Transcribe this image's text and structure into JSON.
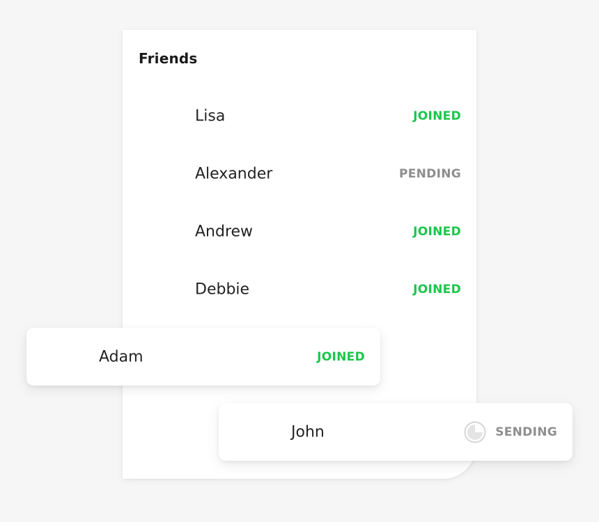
{
  "panel": {
    "title": "Friends"
  },
  "friends": [
    {
      "name": "Lisa",
      "status": "JOINED"
    },
    {
      "name": "Alexander",
      "status": "PENDING"
    },
    {
      "name": "Andrew",
      "status": "JOINED"
    },
    {
      "name": "Debbie",
      "status": "JOINED"
    }
  ],
  "floating_cards": {
    "adam": {
      "name": "Adam",
      "status": "JOINED"
    },
    "john": {
      "name": "John",
      "status": "SENDING",
      "icon": "progress-spinner-icon",
      "progress": 0.25
    }
  },
  "colors": {
    "joined": "#1bc64a",
    "pending": "#8e8e8e",
    "sending": "#8e8e8e",
    "background": "#f6f6f6",
    "card": "#ffffff"
  }
}
